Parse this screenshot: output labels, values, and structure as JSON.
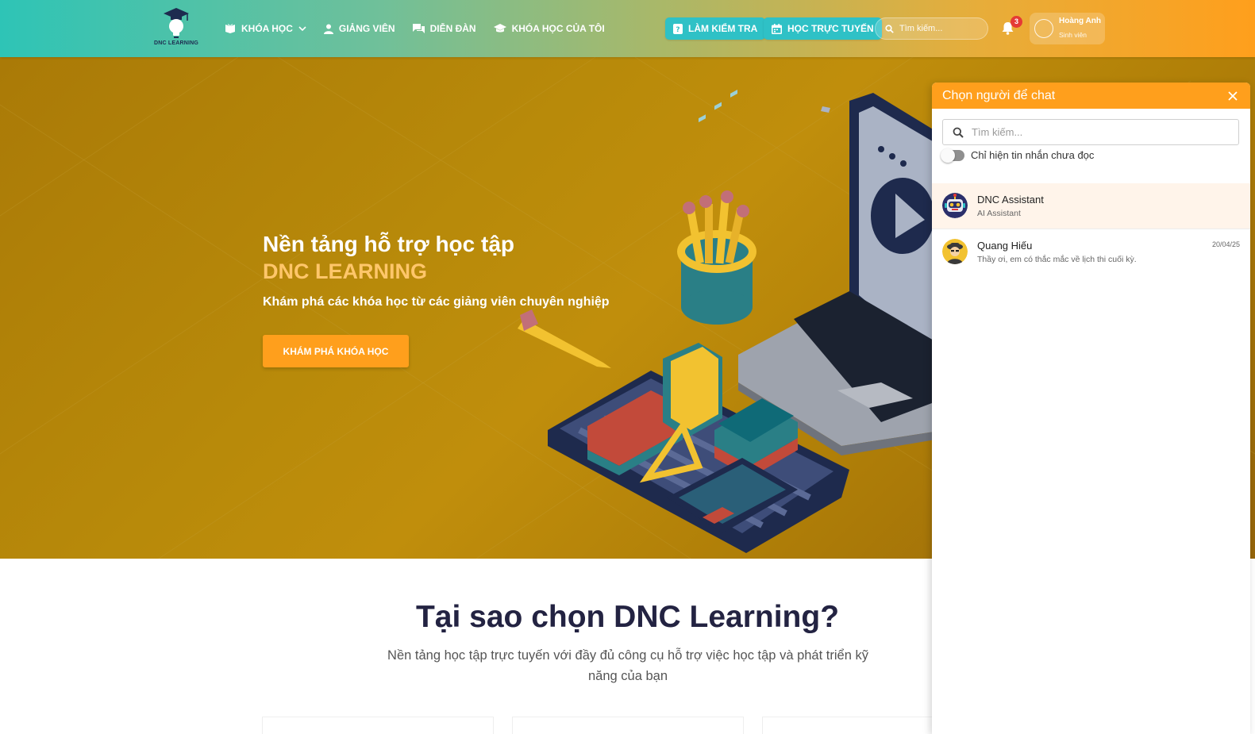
{
  "header": {
    "logo_text": "DNC LEARNING",
    "nav": [
      {
        "label": "KHÓA HỌC",
        "icon": "book-open-icon",
        "has_dropdown": true
      },
      {
        "label": "GIẢNG VIÊN",
        "icon": "person-icon"
      },
      {
        "label": "DIỄN ĐÀN",
        "icon": "forum-icon"
      },
      {
        "label": "KHÓA HỌC CỦA TÔI",
        "icon": "graduation-cap-icon"
      }
    ],
    "test_button": "LÀM KIỂM TRA",
    "online_button": "HỌC TRỰC TUYẾN",
    "search_placeholder": "Tìm kiếm...",
    "notification_count": "3",
    "user": {
      "name": "Hoàng Anh",
      "role": "Sinh viên"
    }
  },
  "hero": {
    "title": "Nền tảng hỗ trợ học tập",
    "brand": "DNC LEARNING",
    "subtitle": "Khám phá các khóa học từ các giảng viên chuyên nghiệp",
    "cta": "KHÁM PHÁ KHÓA HỌC"
  },
  "why": {
    "title": "Tại sao chọn DNC Learning?",
    "description": "Nền tảng học tập trực tuyến với đầy đủ công cụ hỗ trợ việc học tập và phát triển kỹ năng của bạn"
  },
  "chat": {
    "title": "Chọn người để chat",
    "search_placeholder": "Tìm kiếm...",
    "unread_toggle_label": "Chỉ hiện tin nhắn chưa đọc",
    "contacts": [
      {
        "name": "DNC Assistant",
        "subtitle": "AI Assistant",
        "date": ""
      },
      {
        "name": "Quang Hiếu",
        "subtitle": "Thầy ơi, em có thắc mắc về lịch thi cuối kỳ.",
        "date": "20/04/25"
      }
    ]
  },
  "colors": {
    "primary_teal": "#2ec4b6",
    "accent_orange": "#ff9f1c",
    "hero_gold": "#b88a0a",
    "badge_red": "#e53935"
  }
}
